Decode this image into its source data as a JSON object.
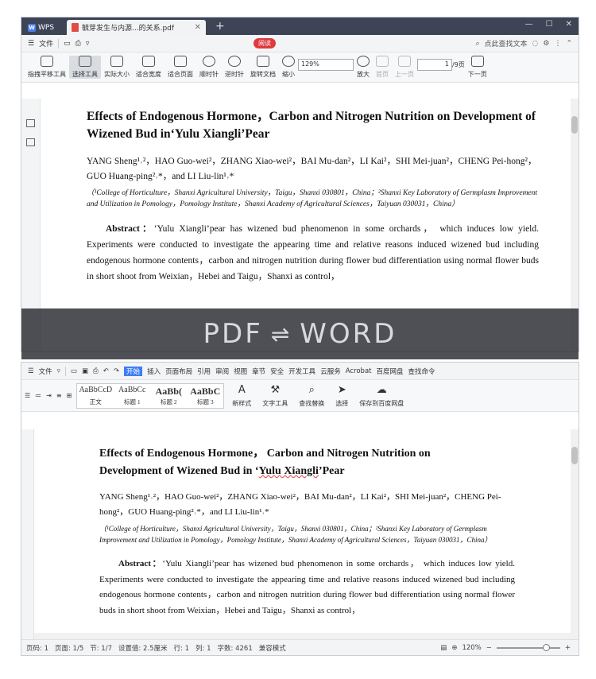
{
  "top": {
    "wps_label": "WPS",
    "tab_label": "毓芽发生与内源...的关系.pdf",
    "menu": {
      "file": "文件",
      "read": "阅读",
      "search": "点此查找文本"
    },
    "toolbar": {
      "hand": "指拽平移工具",
      "select": "选择工具",
      "actual": "实际大小",
      "fitwidth": "适合宽度",
      "fitpage": "适合页面",
      "cw": "顺时针",
      "ccw": "逆时针",
      "rotate": "旋转文档",
      "zoomout": "缩小",
      "zoom": "129%",
      "zoomin": "放大",
      "first": "首页",
      "prev": "上一页",
      "page": "1",
      "pages": "/9页",
      "next": "下一页"
    }
  },
  "banner": {
    "left": "PDF",
    "arrows": "⇌",
    "right": "WORD"
  },
  "doc": {
    "title": "Effects of Endogenous Hormone，Carbon and Nitrogen Nutrition on Development of Wizened Bud in‘Yulu Xiangli’Pear",
    "title_line1": "Effects of Endogenous Hormone， Carbon and Nitrogen Nutrition on",
    "title_line2a": "Development of Wizened Bud in ‘",
    "title_sq": "Yulu Xiangli",
    "title_line2b": "’Pear",
    "authors": "YANG Sheng¹˒²，HAO Guo-wei²，ZHANG Xiao-wei²，BAI Mu-dan²，LI Kai²，SHI Mei-juan²，CHENG Pei-hong²，GUO Huang-ping²˒*，and LI Liu-lin¹˒*",
    "affiliation": "（¹College of Horticulture，Shanxi Agricultural University，Taigu，Shanxi 030801，China；²Shanxi Key Laboratory of Germplasm Improvement and Utilization in Pomology，Pomology Institute，Shanxi Academy of Agricultural Sciences，Taiyuan 030031，China）",
    "abstract_label": "Abstract：",
    "abstract": "‘Yulu Xiangli’pear has wizened bud phenomenon in some orchards， which induces low yield. Experiments were conducted to investigate the appearing time and relative reasons induced wizened bud including endogenous hormone contents，carbon and nitrogen nutrition during flower bud differentiation using normal flower buds in short shoot from Weixian，Hebei and Taigu，Shanxi as control，"
  },
  "bottom": {
    "menu": {
      "file": "文件",
      "start": "开始",
      "insert": "插入",
      "layout": "页面布局",
      "ref": "引用",
      "review": "审阅",
      "view": "视图",
      "chapter": "章节",
      "security": "安全",
      "dev": "开发工具",
      "cloud": "云服务",
      "acrobat": "Acrobat",
      "baidu": "百度网盘",
      "find": "查找命令"
    },
    "styles": [
      {
        "sample": "AaBbCcD",
        "name": "正文"
      },
      {
        "sample": "AaBbCc",
        "name": "标题 1"
      },
      {
        "sample": "AaBb(",
        "name": "标题 2"
      },
      {
        "sample": "AaBbC",
        "name": "标题 3"
      }
    ],
    "tools": {
      "newstyle": "新样式",
      "texttool": "文字工具",
      "findreplace": "查找替换",
      "select": "选择",
      "savebaidu": "保存到百度网盘"
    },
    "status": {
      "page": "页码: 1",
      "pages": "页面: 1/5",
      "section": "节: 1/7",
      "setting": "设置值: 2.5厘米",
      "row": "行: 1",
      "col": "列: 1",
      "words": "字数: 4261",
      "compat": "兼容模式",
      "zoom": "120%"
    }
  }
}
